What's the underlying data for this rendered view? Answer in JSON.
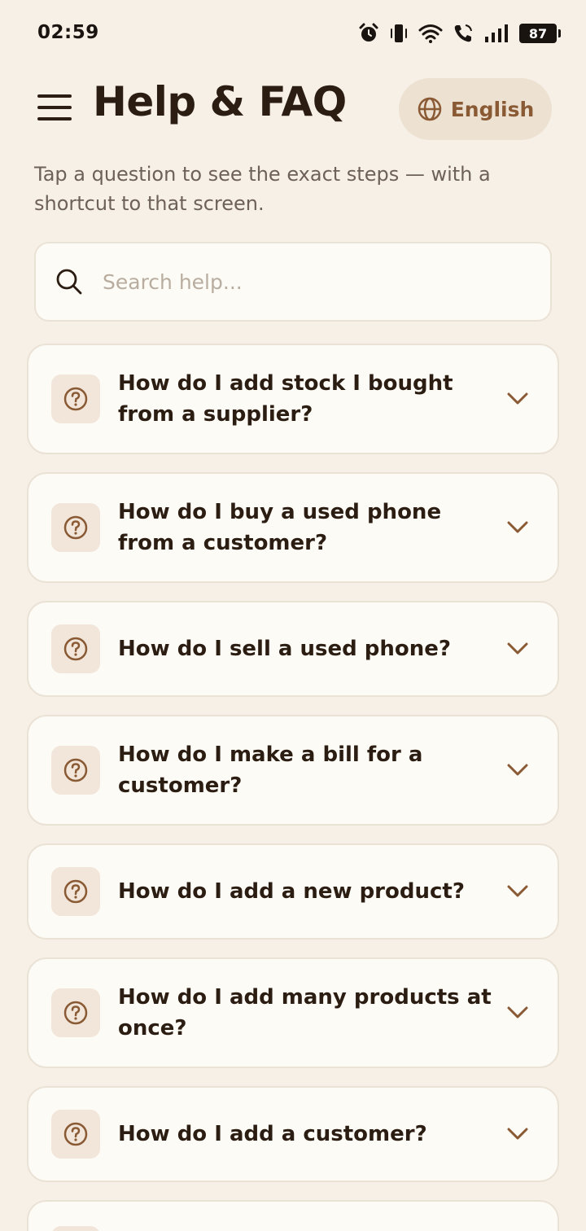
{
  "status_bar": {
    "time": "02:59",
    "battery": "87"
  },
  "header": {
    "title": "Help & FAQ",
    "language_label": "English"
  },
  "subtitle": "Tap a question to see the exact steps — with a shortcut to that screen.",
  "search": {
    "placeholder": "Search help...",
    "value": ""
  },
  "faq": [
    {
      "question": "How do I add stock I bought from a supplier?"
    },
    {
      "question": "How do I buy a used phone from a customer?"
    },
    {
      "question": "How do I sell a used phone?"
    },
    {
      "question": "How do I make a bill for a customer?"
    },
    {
      "question": "How do I add a new product?"
    },
    {
      "question": "How do I add many products at once?"
    },
    {
      "question": "How do I add a customer?"
    }
  ],
  "colors": {
    "background": "#f7f0e7",
    "card": "#fdfbf6",
    "accent": "#8a5a35",
    "text": "#2c1d12"
  },
  "icons": {
    "menu": "hamburger-icon",
    "language": "globe-icon",
    "search": "search-icon",
    "faq_item": "question-circle-icon",
    "expand": "chevron-down-icon"
  }
}
